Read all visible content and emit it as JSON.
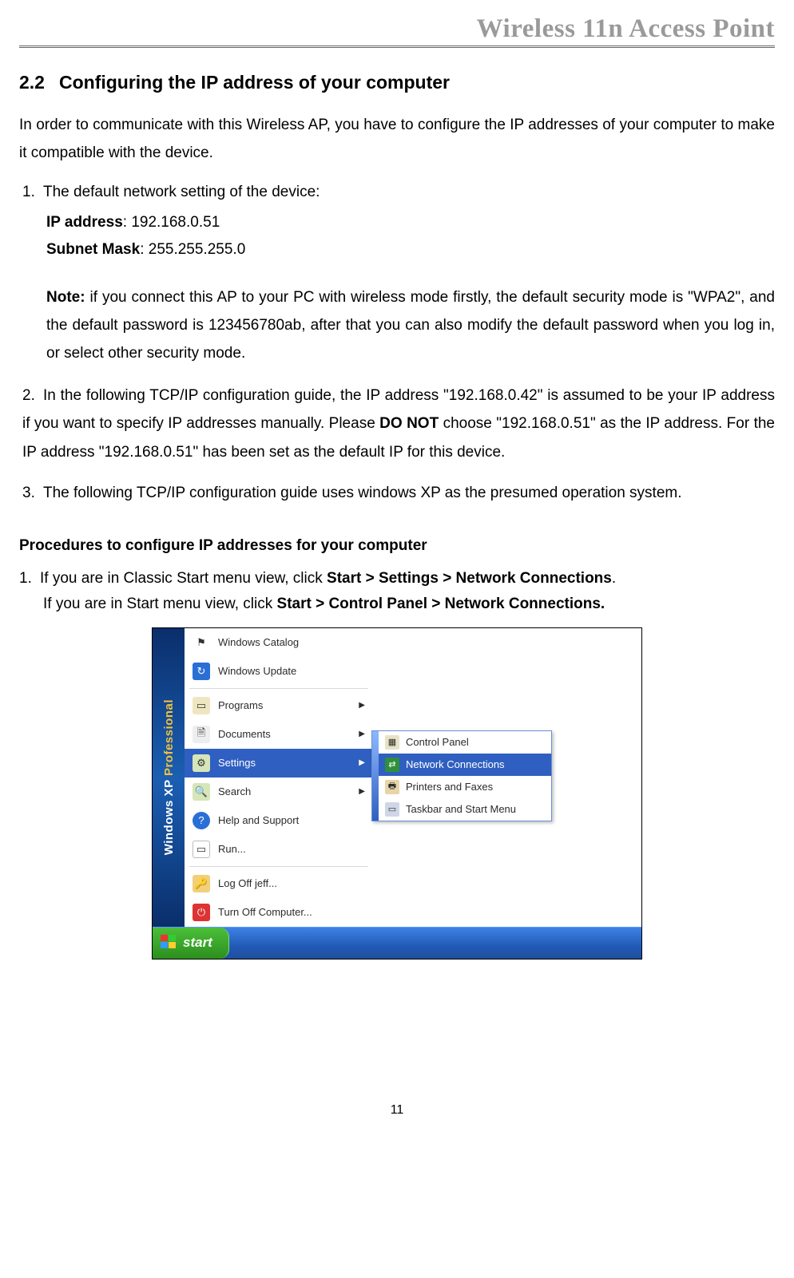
{
  "header": {
    "title": "Wireless 11n Access Point"
  },
  "section": {
    "number": "2.2",
    "title": "Configuring the IP address of your computer"
  },
  "intro": "In order to communicate with this Wireless AP, you have to configure the IP addresses of your computer to make it compatible with the device.",
  "list1": {
    "num": "1.",
    "text": "The default network setting of the device:",
    "ip_label": "IP address",
    "ip_value": ": 192.168.0.51",
    "mask_label": "Subnet Mask",
    "mask_value": ": 255.255.255.0"
  },
  "note": {
    "label": "Note:",
    "text": " if you connect this AP to your PC with wireless mode firstly, the default security mode is \"WPA2\", and the default password is 123456780ab, after that you can also modify the default password when you log in, or select other security mode."
  },
  "list2": {
    "num": "2.",
    "pre": "In the following TCP/IP configuration guide, the IP address \"192.168.0.42\" is assumed to be your IP address if you want to specify IP addresses manually. Please ",
    "bold": "DO NOT",
    "post": " choose \"192.168.0.51\" as the IP address. For the IP address \"192.168.0.51\" has been set as the default IP for this device."
  },
  "list3": {
    "num": "3.",
    "text": "The following TCP/IP configuration guide uses windows XP as the presumed operation system."
  },
  "procedures": {
    "heading": "Procedures to configure IP addresses for your computer",
    "item1_num": "1.",
    "item1_pre": "If you are in Classic Start menu view, click ",
    "item1_bold": "Start > Settings > Network Connections",
    "item1_post": ".",
    "item1b_pre": "If you are in Start menu view, click ",
    "item1b_bold": "Start > Control Panel > Network Connections."
  },
  "screenshot": {
    "side_win": "Windows ",
    "side_xp": "XP ",
    "side_pro": "Professional",
    "menu": {
      "catalog": "Windows Catalog",
      "update": "Windows Update",
      "programs": "Programs",
      "documents": "Documents",
      "settings": "Settings",
      "search": "Search",
      "help": "Help and Support",
      "run": "Run...",
      "logoff": "Log Off jeff...",
      "turnoff": "Turn Off Computer..."
    },
    "submenu": {
      "cp": "Control Panel",
      "net": "Network Connections",
      "print": "Printers and Faxes",
      "task": "Taskbar and Start Menu"
    },
    "start_label": "start"
  },
  "page_number": "11"
}
